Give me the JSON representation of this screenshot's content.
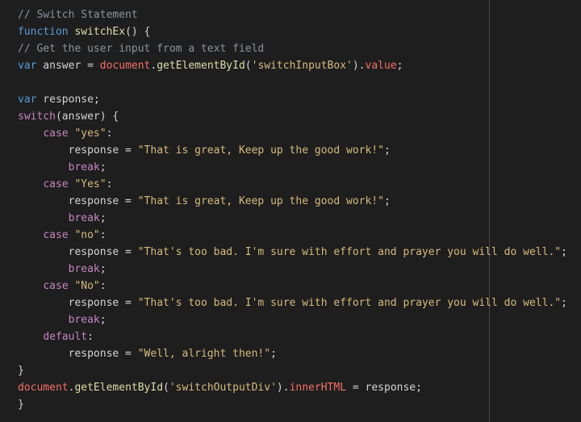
{
  "editor": {
    "lines": [
      [
        {
          "t": "// Switch Statement",
          "c": "comment"
        }
      ],
      [
        {
          "t": "function",
          "c": "keyword"
        },
        {
          "t": " ",
          "c": "plain"
        },
        {
          "t": "switchEx",
          "c": "func"
        },
        {
          "t": "() {",
          "c": "plain"
        }
      ],
      [
        {
          "t": "// Get the user input from a text field",
          "c": "comment"
        }
      ],
      [
        {
          "t": "var",
          "c": "keyword"
        },
        {
          "t": " answer = ",
          "c": "plain"
        },
        {
          "t": "document",
          "c": "object"
        },
        {
          "t": ".",
          "c": "plain"
        },
        {
          "t": "getElementById",
          "c": "func"
        },
        {
          "t": "(",
          "c": "plain"
        },
        {
          "t": "'switchInputBox'",
          "c": "string"
        },
        {
          "t": ").",
          "c": "plain"
        },
        {
          "t": "value",
          "c": "prop"
        },
        {
          "t": ";",
          "c": "plain"
        }
      ],
      [],
      [
        {
          "t": "var",
          "c": "keyword"
        },
        {
          "t": " response;",
          "c": "plain"
        }
      ],
      [
        {
          "t": "switch",
          "c": "control"
        },
        {
          "t": "(answer) {",
          "c": "plain"
        }
      ],
      [
        {
          "t": "    ",
          "c": "plain"
        },
        {
          "t": "case",
          "c": "control"
        },
        {
          "t": " ",
          "c": "plain"
        },
        {
          "t": "\"yes\"",
          "c": "string"
        },
        {
          "t": ":",
          "c": "plain"
        }
      ],
      [
        {
          "t": "        response = ",
          "c": "plain"
        },
        {
          "t": "\"That is great, Keep up the good work!\"",
          "c": "string"
        },
        {
          "t": ";",
          "c": "plain"
        }
      ],
      [
        {
          "t": "        ",
          "c": "plain"
        },
        {
          "t": "break",
          "c": "control"
        },
        {
          "t": ";",
          "c": "plain"
        }
      ],
      [
        {
          "t": "    ",
          "c": "plain"
        },
        {
          "t": "case",
          "c": "control"
        },
        {
          "t": " ",
          "c": "plain"
        },
        {
          "t": "\"Yes\"",
          "c": "string"
        },
        {
          "t": ":",
          "c": "plain"
        }
      ],
      [
        {
          "t": "        response = ",
          "c": "plain"
        },
        {
          "t": "\"That is great, Keep up the good work!\"",
          "c": "string"
        },
        {
          "t": ";",
          "c": "plain"
        }
      ],
      [
        {
          "t": "        ",
          "c": "plain"
        },
        {
          "t": "break",
          "c": "control"
        },
        {
          "t": ";",
          "c": "plain"
        }
      ],
      [
        {
          "t": "    ",
          "c": "plain"
        },
        {
          "t": "case",
          "c": "control"
        },
        {
          "t": " ",
          "c": "plain"
        },
        {
          "t": "\"no\"",
          "c": "string"
        },
        {
          "t": ":",
          "c": "plain"
        }
      ],
      [
        {
          "t": "        response = ",
          "c": "plain"
        },
        {
          "t": "\"That's too bad. I'm sure with effort and prayer you will do well.\"",
          "c": "string"
        },
        {
          "t": ";",
          "c": "plain"
        }
      ],
      [
        {
          "t": "        ",
          "c": "plain"
        },
        {
          "t": "break",
          "c": "control"
        },
        {
          "t": ";",
          "c": "plain"
        }
      ],
      [
        {
          "t": "    ",
          "c": "plain"
        },
        {
          "t": "case",
          "c": "control"
        },
        {
          "t": " ",
          "c": "plain"
        },
        {
          "t": "\"No\"",
          "c": "string"
        },
        {
          "t": ":",
          "c": "plain"
        }
      ],
      [
        {
          "t": "        response = ",
          "c": "plain"
        },
        {
          "t": "\"That's too bad. I'm sure with effort and prayer you will do well.\"",
          "c": "string"
        },
        {
          "t": ";",
          "c": "plain"
        }
      ],
      [
        {
          "t": "        ",
          "c": "plain"
        },
        {
          "t": "break",
          "c": "control"
        },
        {
          "t": ";",
          "c": "plain"
        }
      ],
      [
        {
          "t": "    ",
          "c": "plain"
        },
        {
          "t": "default",
          "c": "control"
        },
        {
          "t": ":",
          "c": "plain"
        }
      ],
      [
        {
          "t": "        response = ",
          "c": "plain"
        },
        {
          "t": "\"Well, alright then!\"",
          "c": "string"
        },
        {
          "t": ";",
          "c": "plain"
        }
      ],
      [
        {
          "t": "}",
          "c": "plain"
        }
      ],
      [
        {
          "t": "document",
          "c": "object"
        },
        {
          "t": ".",
          "c": "plain"
        },
        {
          "t": "getElementById",
          "c": "func"
        },
        {
          "t": "(",
          "c": "plain"
        },
        {
          "t": "'switchOutputDiv'",
          "c": "string"
        },
        {
          "t": ").",
          "c": "plain"
        },
        {
          "t": "innerHTML",
          "c": "prop"
        },
        {
          "t": " = response;",
          "c": "plain"
        }
      ],
      [
        {
          "t": "}",
          "c": "plain"
        }
      ]
    ]
  },
  "colors": {
    "background": "#1e1e1e",
    "comment": "#8b949e",
    "keyword": "#569cd6",
    "control": "#c586c0",
    "function": "#dcdcaa",
    "string": "#d7ba7d",
    "object": "#f47067",
    "plain": "#d4d4d4",
    "ruler": "#4a4a4a"
  }
}
